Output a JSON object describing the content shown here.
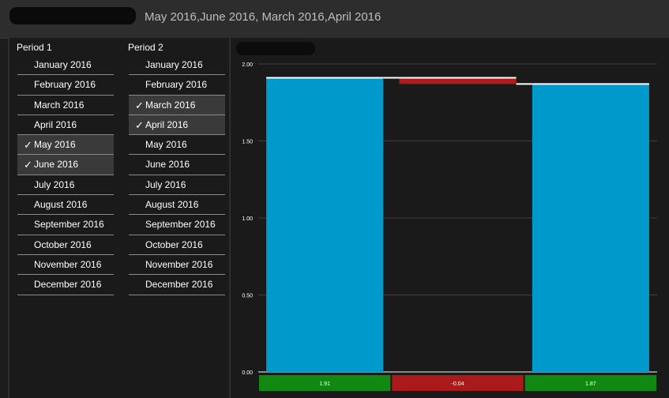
{
  "header": {
    "subtitle": "May 2016,June 2016, March 2016,April 2016"
  },
  "period1": {
    "title": "Period 1",
    "items": [
      {
        "label": "January 2016",
        "selected": false
      },
      {
        "label": "February 2016",
        "selected": false
      },
      {
        "label": "March 2016",
        "selected": false
      },
      {
        "label": "April 2016",
        "selected": false
      },
      {
        "label": "May 2016",
        "selected": true
      },
      {
        "label": "June 2016",
        "selected": true
      },
      {
        "label": "July 2016",
        "selected": false
      },
      {
        "label": "August 2016",
        "selected": false
      },
      {
        "label": "September 2016",
        "selected": false
      },
      {
        "label": "October 2016",
        "selected": false
      },
      {
        "label": "November 2016",
        "selected": false
      },
      {
        "label": "December 2016",
        "selected": false
      }
    ]
  },
  "period2": {
    "title": "Period 2",
    "items": [
      {
        "label": "January 2016",
        "selected": false
      },
      {
        "label": "February 2016",
        "selected": false
      },
      {
        "label": "March 2016",
        "selected": true
      },
      {
        "label": "April 2016",
        "selected": true
      },
      {
        "label": "May 2016",
        "selected": false
      },
      {
        "label": "June 2016",
        "selected": false
      },
      {
        "label": "July 2016",
        "selected": false
      },
      {
        "label": "August 2016",
        "selected": false
      },
      {
        "label": "September 2016",
        "selected": false
      },
      {
        "label": "October 2016",
        "selected": false
      },
      {
        "label": "November 2016",
        "selected": false
      },
      {
        "label": "December 2016",
        "selected": false
      }
    ]
  },
  "check_glyph": "✓",
  "chart_data": {
    "type": "bar",
    "subtype": "waterfall",
    "y_ticks": [
      "0.00",
      "0.50",
      "1.00",
      "1.50",
      "2.00"
    ],
    "ylim": [
      0,
      2
    ],
    "grid": true,
    "bars": [
      {
        "kind": "total",
        "start": 0,
        "end": 1.91,
        "label": "1.91",
        "color": "#0099cc"
      },
      {
        "kind": "delta",
        "start": 1.91,
        "end": 1.87,
        "label": "-0.04",
        "color": "#b01c1c"
      },
      {
        "kind": "total",
        "start": 0,
        "end": 1.87,
        "label": "1.87",
        "color": "#0099cc"
      }
    ],
    "label_colors": {
      "positive": "#118811",
      "negative": "#aa1a1a"
    }
  }
}
